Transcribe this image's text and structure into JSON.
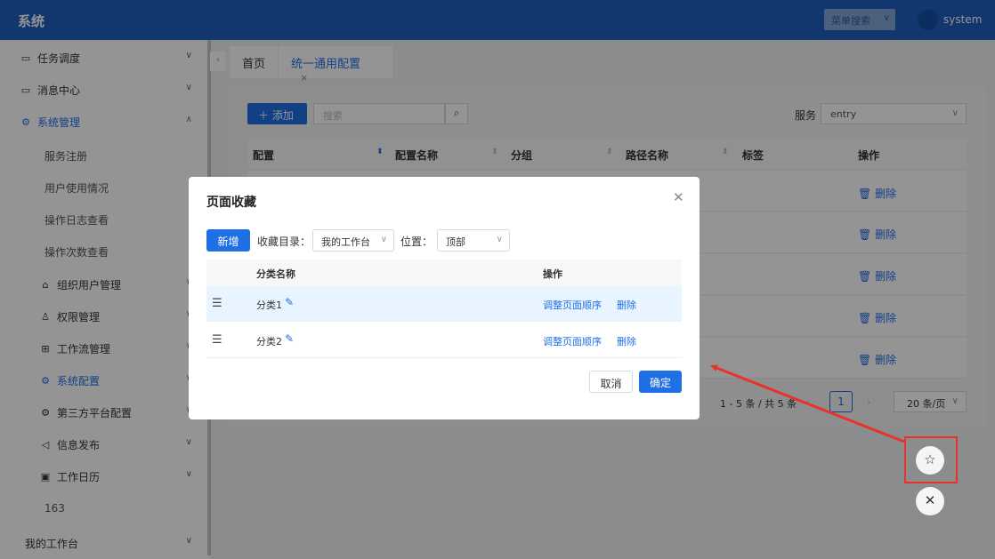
{
  "header": {
    "brand": "系统",
    "menu_search_placeholder": "菜单搜索",
    "user": "system"
  },
  "sidebar": {
    "items": [
      {
        "label": "任务调度",
        "icon": "folder-icon"
      },
      {
        "label": "消息中心",
        "icon": "folder-icon"
      },
      {
        "label": "系统管理",
        "icon": "gear-icon"
      },
      {
        "label": "服务注册"
      },
      {
        "label": "用户使用情况"
      },
      {
        "label": "操作日志查看"
      },
      {
        "label": "操作次数查看"
      },
      {
        "label": "组织用户管理",
        "icon": "bank-icon"
      },
      {
        "label": "权限管理",
        "icon": "user-icon"
      },
      {
        "label": "工作流管理",
        "icon": "flow-icon"
      },
      {
        "label": "系统配置",
        "icon": "gear-icon"
      },
      {
        "label": "第三方平台配置",
        "icon": "gear-icon"
      },
      {
        "label": "信息发布",
        "icon": "speaker-icon"
      },
      {
        "label": "工作日历",
        "icon": "calendar-icon"
      },
      {
        "label": "163"
      },
      {
        "label": "我的工作台"
      }
    ]
  },
  "tabs": [
    {
      "label": "首页"
    },
    {
      "label": "统一通用配置",
      "close": "×"
    }
  ],
  "toolbar": {
    "add_label": "添加",
    "search_placeholder": "搜索",
    "service_label": "服务",
    "service_value": "entry"
  },
  "table": {
    "columns": [
      "配置",
      "配置名称",
      "分组",
      "路径名称",
      "标签",
      "操作"
    ],
    "row_action": "删除"
  },
  "pager": {
    "summary": "1 - 5 条 / 共 5 条",
    "current": "1",
    "size": "20 条/页"
  },
  "modal": {
    "title": "页面收藏",
    "new_label": "新增",
    "dir_label": "收藏目录：",
    "dir_value": "我的工作台",
    "pos_label": "位置：",
    "pos_value": "顶部",
    "columns": [
      "分类名称",
      "操作"
    ],
    "rows": [
      {
        "name": "分类1",
        "action1": "调整页面顺序",
        "action2": "删除"
      },
      {
        "name": "分类2",
        "action1": "调整页面顺序",
        "action2": "删除"
      }
    ],
    "cancel_label": "取消",
    "ok_label": "确定"
  },
  "colors": {
    "primary": "#1f6fe5",
    "header": "#1f5fbd",
    "annotation": "#e8332b"
  }
}
